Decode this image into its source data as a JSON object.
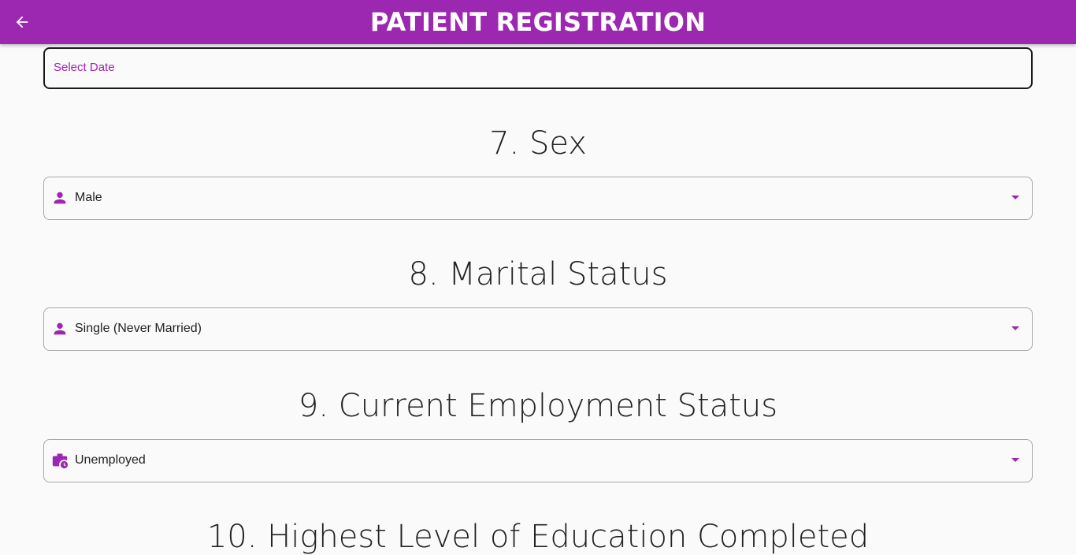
{
  "appbar": {
    "title": "PATIENT REGISTRATION",
    "back_icon": "arrow-back-icon",
    "color": "#9c27b0"
  },
  "date_field": {
    "label": "Select Date"
  },
  "sections": {
    "sex": {
      "title": "7. Sex",
      "icon": "person-icon",
      "value": "Male"
    },
    "marital": {
      "title": "8. Marital Status",
      "icon": "person-icon",
      "value": "Single (Never Married)"
    },
    "employment": {
      "title": "9. Current Employment Status",
      "icon": "work-history-icon",
      "value": "Unemployed"
    },
    "education": {
      "title": "10. Highest Level of Education Completed"
    }
  }
}
